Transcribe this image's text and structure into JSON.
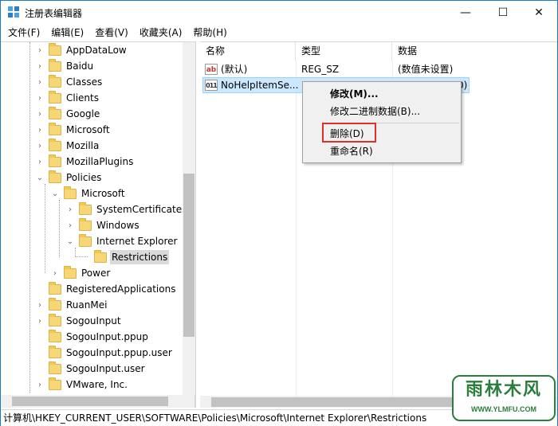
{
  "window": {
    "title": "注册表编辑器",
    "controls": {
      "minimize": "—",
      "maximize": "☐",
      "close": "✕"
    }
  },
  "menubar": {
    "items": [
      "文件(F)",
      "编辑(E)",
      "查看(V)",
      "收藏夹(A)",
      "帮助(H)"
    ]
  },
  "tree": {
    "items": [
      {
        "label": "AppDataLow",
        "expander": "›"
      },
      {
        "label": "Baidu",
        "expander": "›"
      },
      {
        "label": "Classes",
        "expander": "›"
      },
      {
        "label": "Clients",
        "expander": "›"
      },
      {
        "label": "Google",
        "expander": "›"
      },
      {
        "label": "Microsoft",
        "expander": "›"
      },
      {
        "label": "Mozilla",
        "expander": "›"
      },
      {
        "label": "MozillaPlugins",
        "expander": "›"
      },
      {
        "label": "Policies",
        "expander": "⌄"
      },
      {
        "label": "Microsoft",
        "expander": "⌄"
      },
      {
        "label": "SystemCertificates",
        "expander": "›"
      },
      {
        "label": "Windows",
        "expander": "›"
      },
      {
        "label": "Internet Explorer",
        "expander": "⌄"
      },
      {
        "label": "Restrictions",
        "expander": ""
      },
      {
        "label": "Power",
        "expander": "›"
      },
      {
        "label": "RegisteredApplications",
        "expander": ""
      },
      {
        "label": "RuanMei",
        "expander": "›"
      },
      {
        "label": "SogouInput",
        "expander": "›"
      },
      {
        "label": "SogouInput.ppup",
        "expander": ""
      },
      {
        "label": "SogouInput.ppup.user",
        "expander": ""
      },
      {
        "label": "SogouInput.user",
        "expander": ""
      },
      {
        "label": "VMware, Inc.",
        "expander": "›"
      }
    ]
  },
  "list": {
    "columns": [
      "名称",
      "类型",
      "数据"
    ],
    "rows": [
      {
        "icon": "ab",
        "name": "(默认)",
        "type": "REG_SZ",
        "data": "(数值未设置)"
      },
      {
        "icon": "011",
        "name": "NoHelpItemSe...",
        "type": "",
        "data": "0)"
      }
    ]
  },
  "context_menu": {
    "items": [
      "修改(M)...",
      "修改二进制数据(B)...",
      "删除(D)",
      "重命名(R)"
    ],
    "highlight_color": "#e0302a"
  },
  "statusbar": {
    "path": "计算机\\HKEY_CURRENT_USER\\SOFTWARE\\Policies\\Microsoft\\Internet Explorer\\Restrictions"
  },
  "watermark": {
    "title": "雨林木风",
    "url": "WWW.YLMFU.COM",
    "color": "#2a7d3c"
  }
}
